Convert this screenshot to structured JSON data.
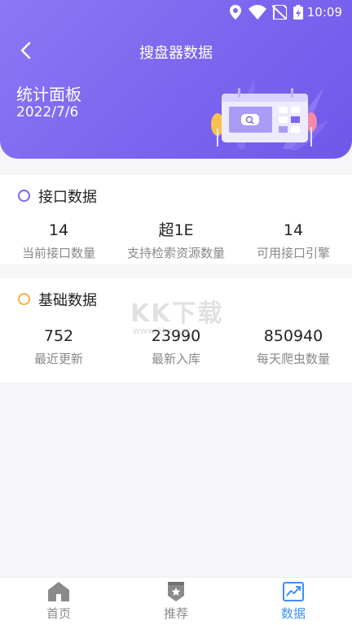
{
  "statusbar": {
    "time": "10:09"
  },
  "header": {
    "title": "搜盘器数据",
    "panel_title": "统计面板",
    "panel_date": "2022/7/6"
  },
  "sections": [
    {
      "title": "接口数据",
      "stats": [
        {
          "value": "14",
          "label": "当前接口数量"
        },
        {
          "value": "超1E",
          "label": "支持检索资源数量"
        },
        {
          "value": "14",
          "label": "可用接口引擎"
        }
      ]
    },
    {
      "title": "基础数据",
      "stats": [
        {
          "value": "752",
          "label": "最近更新"
        },
        {
          "value": "23990",
          "label": "最新入库"
        },
        {
          "value": "850940",
          "label": "每天爬虫数量"
        }
      ]
    }
  ],
  "watermark": {
    "text": "KK下载",
    "sub": "www.kkx.net"
  },
  "tabbar": {
    "items": [
      {
        "label": "首页",
        "icon": "home-icon"
      },
      {
        "label": "推荐",
        "icon": "badge-star-icon"
      },
      {
        "label": "数据",
        "icon": "chart-icon"
      }
    ],
    "active": "数据"
  },
  "colors": {
    "header_gradient_start": "#8b78f4",
    "header_gradient_end": "#6f58ea",
    "section1_dot": "#7b66ee",
    "section2_dot": "#f2b33f",
    "tab_active": "#3e8ef5"
  }
}
